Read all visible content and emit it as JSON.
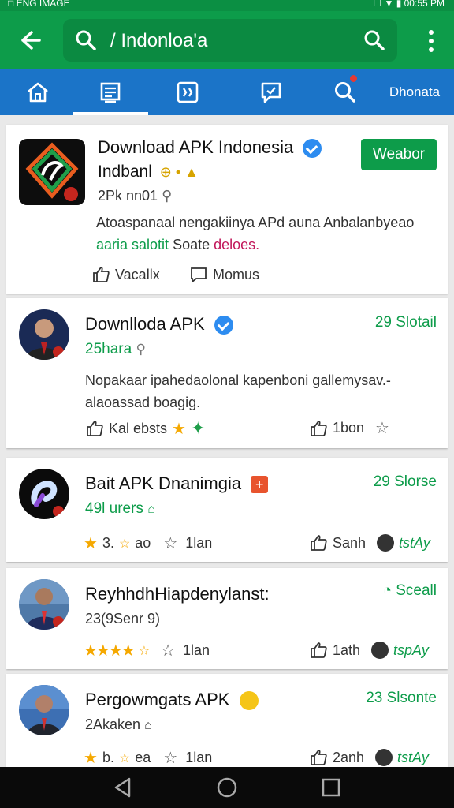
{
  "status": {
    "left": "□ ENG IMAGE",
    "right": "☐ ▼ ▮ 00:55 PM"
  },
  "search": {
    "query": "/ Indonloa'a"
  },
  "tabs": [
    {
      "name": "home"
    },
    {
      "name": "feed"
    },
    {
      "name": "apps"
    },
    {
      "name": "messages"
    },
    {
      "name": "search"
    },
    {
      "name": "donate",
      "label": "Dhonata"
    }
  ],
  "cards": [
    {
      "title": "Download APK Indonesia",
      "subtitle": "Indbanl",
      "meta": "2Pk nn01",
      "desc_line1": "Atoaspanaal nengakiinya APd auna Anbalanbyeao",
      "desc_line2_green": "aaria salotit",
      "desc_line2_black": "Soate",
      "desc_line2_pink": "deloes.",
      "action_button": "Weabor",
      "action1": "Vacallx",
      "action2": "Momus"
    },
    {
      "title": "Downlloda APK",
      "subtitle": "25hara",
      "right": "29 Slotail",
      "desc_line1": "Nopakaar ipahedaolonal kapenboni gallemysav.-",
      "desc_line2": "alaoassad boagig.",
      "action1": "Kal ebsts",
      "action2": "1bon"
    },
    {
      "title": "Bait APK Dnanimgia",
      "subtitle": "49l urers",
      "right": "29 Slorse",
      "rating_text": "3.",
      "rating_text2": "ao",
      "count": "1lan",
      "likes": "Sanh",
      "tag": "tstAy"
    },
    {
      "title": "ReyhhdhHiapdenylanst:",
      "subtitle": "23(9Senr 9)",
      "right": "Sceall",
      "count": "1lan",
      "likes": "1ath",
      "tag": "tspAy"
    },
    {
      "title": "Pergowmgats APK",
      "subtitle": "2Akaken",
      "right": "23 Slsonte",
      "rating_text": "b.",
      "rating_text2": "ea",
      "count": "1lan",
      "likes": "2anh",
      "tag": "tstAy"
    }
  ]
}
